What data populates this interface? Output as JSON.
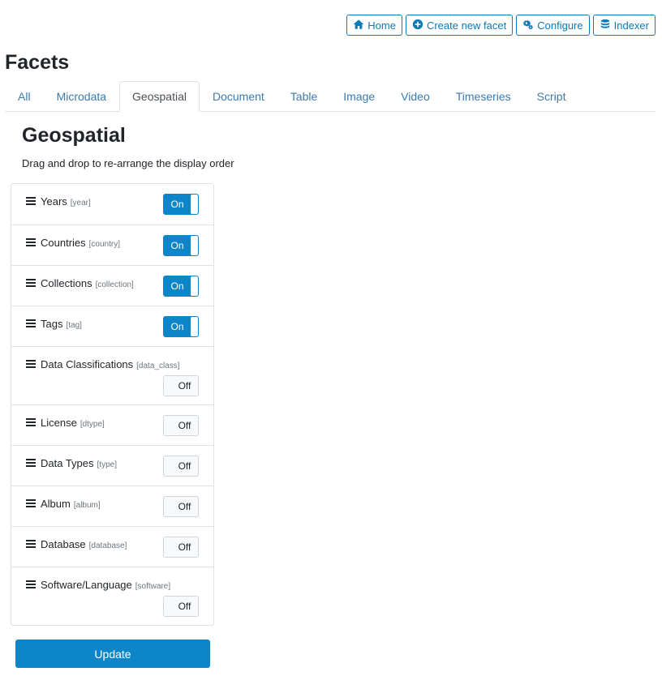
{
  "toolbar": {
    "home": {
      "label": "Home",
      "icon": "home-icon"
    },
    "create": {
      "label": "Create new facet",
      "icon": "plus-circle-icon"
    },
    "configure": {
      "label": "Configure",
      "icon": "gears-icon"
    },
    "indexer": {
      "label": "Indexer",
      "icon": "database-icon"
    }
  },
  "page_title": "Facets",
  "tabs": [
    {
      "label": "All",
      "active": false
    },
    {
      "label": "Microdata",
      "active": false
    },
    {
      "label": "Geospatial",
      "active": true
    },
    {
      "label": "Document",
      "active": false
    },
    {
      "label": "Table",
      "active": false
    },
    {
      "label": "Image",
      "active": false
    },
    {
      "label": "Video",
      "active": false
    },
    {
      "label": "Timeseries",
      "active": false
    },
    {
      "label": "Script",
      "active": false
    }
  ],
  "section_title": "Geospatial",
  "instructions": "Drag and drop to re-arrange the display order",
  "toggle_labels": {
    "on": "On",
    "off": "Off"
  },
  "facets": [
    {
      "name": "Years",
      "key": "[year]",
      "enabled": true
    },
    {
      "name": "Countries",
      "key": "[country]",
      "enabled": true
    },
    {
      "name": "Collections",
      "key": "[collection]",
      "enabled": true
    },
    {
      "name": "Tags",
      "key": "[tag]",
      "enabled": true
    },
    {
      "name": "Data Classifications",
      "key": "[data_class]",
      "enabled": false
    },
    {
      "name": "License",
      "key": "[dtype]",
      "enabled": false
    },
    {
      "name": "Data Types",
      "key": "[type]",
      "enabled": false
    },
    {
      "name": "Album",
      "key": "[album]",
      "enabled": false
    },
    {
      "name": "Database",
      "key": "[database]",
      "enabled": false
    },
    {
      "name": "Software/Language",
      "key": "[software]",
      "enabled": false
    }
  ],
  "update_label": "Update",
  "colors": {
    "primary": "#0d86c9",
    "link": "#3a7ab0",
    "outline": "#0d7ab8"
  }
}
